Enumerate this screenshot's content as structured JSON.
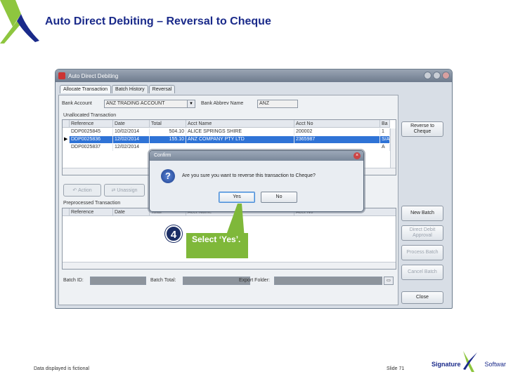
{
  "slide": {
    "title": "Auto Direct Debiting – Reversal to Cheque",
    "footer_note": "Data displayed is fictional",
    "slide_number": "Slide 71",
    "brand_name": "Signature",
    "brand_suffix": "Software",
    "accent": "#1a2a8a",
    "logo_green": "#8ec63f"
  },
  "window": {
    "title": "Auto Direct Debiting",
    "tabs": [
      "Allocate Transaction",
      "Batch History",
      "Reversal"
    ],
    "active_tab": 0,
    "bank_account_label": "Bank Account",
    "bank_account_value": "ANZ TRADING ACCOUNT",
    "bank_abbrev_label": "Bank Abbrev Name",
    "bank_abbrev_value": "ANZ",
    "unallocated_label": "Unallocated Transaction",
    "unallocated_columns": [
      "Reference",
      "Date",
      "Total",
      "Acct Name",
      "Acct No",
      "Ba"
    ],
    "unallocated_rows": [
      [
        "DDP0025845",
        "10/02/2014",
        "504.10",
        "ALICE SPRINGS SHIRE",
        "200002",
        "1"
      ],
      [
        "DDP0025836",
        "12/02/2014",
        "155.10",
        "ANZ COMPANY PTY LTD",
        "2365987",
        "S/A"
      ],
      [
        "DDP0025837",
        "12/02/2014",
        "",
        "",
        "",
        "A"
      ]
    ],
    "selected_row": 1,
    "action_button": "Action",
    "unassign_button": "Unassign",
    "preprocessed_label": "Preprocessed Transaction",
    "preprocessed_columns": [
      "Reference",
      "Date",
      "Total",
      "Acct Name",
      "Acct No"
    ],
    "side_buttons": {
      "reverse": "Reverse to Cheque",
      "new_batch": "New Batch",
      "direct_debit": "Direct Debit Approval",
      "process_batch": "Process Batch",
      "cancel_batch": "Cancel Batch",
      "close": "Close"
    },
    "batch_id_label": "Batch ID:",
    "batch_total_label": "Batch Total:",
    "export_folder_label": "Export Folder:"
  },
  "dialog": {
    "title": "Confirm",
    "message": "Are you sure you want to reverse this transaction to Cheque?",
    "yes": "Yes",
    "no": "No"
  },
  "callout": {
    "step": "4",
    "text": "Select ‘Yes’."
  }
}
